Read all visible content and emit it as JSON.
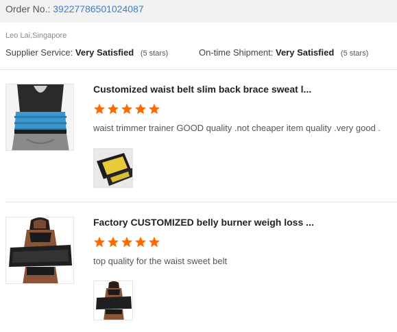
{
  "order": {
    "label": "Order No.:",
    "number": "39227786501024087"
  },
  "reviewer": {
    "name_location": "Leo Lai,Singapore"
  },
  "ratings": {
    "supplier": {
      "label": "Supplier Service:",
      "value": "Very Satisfied",
      "stars_text": "(5 stars)"
    },
    "shipment": {
      "label": "On-time Shipment:",
      "value": "Very Satisfied",
      "stars_text": "(5 stars)"
    }
  },
  "products": [
    {
      "title": "Customized waist belt slim back brace sweat l...",
      "rating": 5,
      "comment": "waist trimmer trainer GOOD quality .not cheaper item quality .very good .",
      "thumb_icon": "waist-belt-blue-product-image",
      "photo_icon": "black-yellow-belt-photo"
    },
    {
      "title": "Factory CUSTOMIZED belly burner weigh loss ...",
      "rating": 5,
      "comment": "top quality for the waist sweet belt",
      "thumb_icon": "belly-burner-belt-product-image",
      "photo_icon": "belly-belt-model-photo"
    }
  ],
  "colors": {
    "order_link": "#3a7cd5",
    "star": "#ff6a00",
    "order_bar_bg": "#f2f2f2"
  }
}
